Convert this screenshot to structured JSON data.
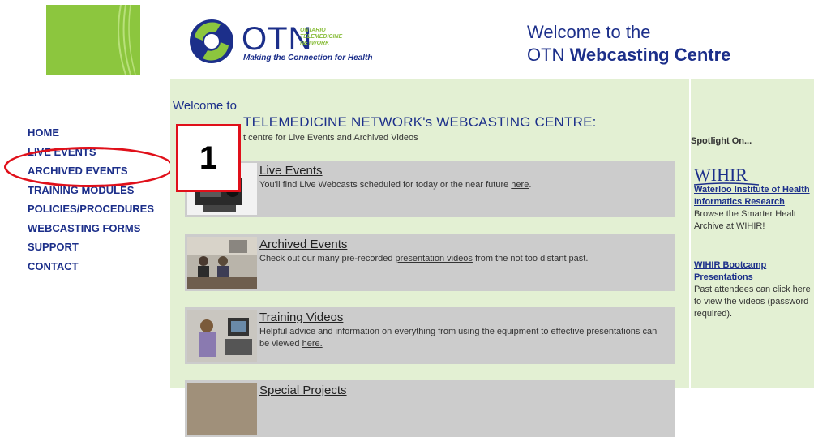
{
  "header": {
    "otn_wordmark": "OTN",
    "otn_subtitle_lines": [
      "ONTARIO",
      "TELEMEDICINE",
      "NETWORK"
    ],
    "otn_tagline": "Making the Connection for Health",
    "welcome_line1": "Welcome to the",
    "welcome_line2_prefix": "OTN ",
    "welcome_line2_bold": "Webcasting Centre"
  },
  "nav": {
    "items": [
      {
        "label": "HOME"
      },
      {
        "label": "LIVE EVENTS"
      },
      {
        "label": "ARCHIVED EVENTS"
      },
      {
        "label": "TRAINING MODULES"
      },
      {
        "label": "POLICIES/PROCEDURES"
      },
      {
        "label": "WEBCASTING FORMS"
      },
      {
        "label": "SUPPORT"
      },
      {
        "label": "CONTACT"
      }
    ]
  },
  "main": {
    "welcome_to": "Welcome to",
    "heading": "TELEMEDICINE NETWORK's WEBCASTING CENTRE:",
    "subheading": "t centre for Live Events and Archived Videos",
    "callout_number": "1",
    "items": [
      {
        "title": "Live Events",
        "desc_before": "You'll find Live Webcasts scheduled for today or the near future ",
        "link": "here",
        "desc_after": "."
      },
      {
        "title": "Archived Events",
        "desc_before": "Check out our many pre-recorded ",
        "link": "presentation videos",
        "desc_after": " from the not too distant past."
      },
      {
        "title": "Training Videos",
        "desc_before": "Helpful advice and information on everything from using the equipment to effective presentations can be viewed ",
        "link": "here.",
        "desc_after": ""
      },
      {
        "title": "Special Projects",
        "desc_before": "",
        "link": "",
        "desc_after": ""
      }
    ]
  },
  "right": {
    "spotlight": "Spotlight On...",
    "wihir_logo": "WIHIR",
    "wihir_link": "Waterloo Institute of Health Informatics Research",
    "wihir_desc": "Browse the Smarter Healt Archive at WIHIR!",
    "bootcamp_link": "WIHIR Bootcamp Presentations",
    "bootcamp_desc": "Past attendees can click here to view the videos (password required)."
  },
  "colors": {
    "accent_blue": "#1c2f8a",
    "leaf_green": "#8cc63e",
    "panel_green": "#e3f0d3",
    "item_gray": "#cccccc",
    "annotation_red": "#e0101a"
  }
}
